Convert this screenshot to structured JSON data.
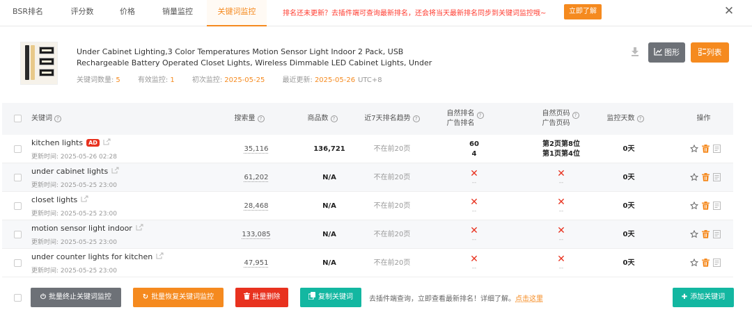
{
  "tabs": [
    {
      "label": "BSR排名",
      "active": false
    },
    {
      "label": "评分数",
      "active": false
    },
    {
      "label": "价格",
      "active": false
    },
    {
      "label": "销量监控",
      "active": false
    },
    {
      "label": "关键词监控",
      "active": true
    }
  ],
  "notice": {
    "text": "排名还未更新？去插件端可查询最新排名，还会将当天最新排名同步到关键词监控哦~",
    "button": "立即了解"
  },
  "close_icon": "close-icon",
  "product": {
    "title": "Under Cabinet Lighting,3 Color Temperatures Motion Sensor Light Indoor 2 Pack, USB Rechargeable Battery Operated Closet Lights, Wireless Dimmable LED Cabinet Lights, Under",
    "keyword_count_label": "关键词数量:",
    "keyword_count": "5",
    "active_monitor_label": "有效监控:",
    "active_monitor": "1",
    "first_monitor_label": "初次监控:",
    "first_monitor": "2025-05-25",
    "last_update_label": "最近更新:",
    "last_update": "2025-05-26",
    "timezone": "UTC+8"
  },
  "view_buttons": {
    "chart": "图形",
    "list": "列表"
  },
  "headers": {
    "keyword": "关键词",
    "search_volume": "搜索量",
    "product_count": "商品数",
    "trend": "近7天排名趋势",
    "organic_rank": "自然排名",
    "ad_rank": "广告排名",
    "organic_page": "自然页码",
    "ad_page": "广告页码",
    "monitor_days": "监控天数",
    "actions": "操作"
  },
  "rows": [
    {
      "keyword": "kitchen lights",
      "ad": "AD",
      "updated": "更新时间: 2025-05-26 02:28",
      "volume": "35,116",
      "products": "136,721",
      "trend": "不在前20页",
      "organic_rank": "60",
      "ad_rank": "4",
      "organic_page": "第2页第8位",
      "ad_page": "第1页第4位",
      "days": "0天"
    },
    {
      "keyword": "under cabinet lights",
      "ad": "",
      "updated": "更新时间: 2025-05-25 23:00",
      "volume": "61,202",
      "products": "N/A",
      "trend": "不在前20页",
      "organic_rank": "✕",
      "ad_rank": "--",
      "organic_page": "✕",
      "ad_page": "--",
      "days": "0天"
    },
    {
      "keyword": "closet lights",
      "ad": "",
      "updated": "更新时间: 2025-05-25 23:00",
      "volume": "28,468",
      "products": "N/A",
      "trend": "不在前20页",
      "organic_rank": "✕",
      "ad_rank": "--",
      "organic_page": "✕",
      "ad_page": "--",
      "days": "0天"
    },
    {
      "keyword": "motion sensor light indoor",
      "ad": "",
      "updated": "更新时间: 2025-05-25 23:00",
      "volume": "133,085",
      "products": "N/A",
      "trend": "不在前20页",
      "organic_rank": "✕",
      "ad_rank": "--",
      "organic_page": "✕",
      "ad_page": "--",
      "days": "0天"
    },
    {
      "keyword": "under counter lights for kitchen",
      "ad": "",
      "updated": "更新时间: 2025-05-25 23:00",
      "volume": "47,951",
      "products": "N/A",
      "trend": "不在前20页",
      "organic_rank": "✕",
      "ad_rank": "--",
      "organic_page": "✕",
      "ad_page": "--",
      "days": "0天"
    }
  ],
  "footer": {
    "stop_monitor": "批量终止关键词监控",
    "resume_monitor": "批量恢复关键词监控",
    "batch_delete": "批量删除",
    "copy_keywords": "复制关键词",
    "note": "去插件端查询，立即查看最新排名！详细了解。",
    "link": "点击这里",
    "add_keyword": "添加关键词"
  },
  "colors": {
    "accent": "#f58a1f",
    "danger": "#e8321f",
    "teal": "#13b7a1",
    "gray_button": "#6d7177"
  }
}
